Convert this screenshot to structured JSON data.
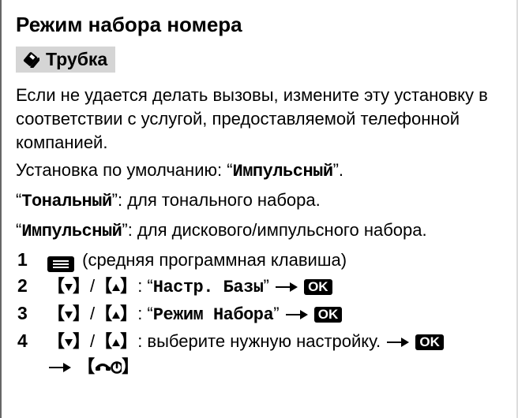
{
  "title": "Режим набора номера",
  "subheader": "Трубка",
  "desc1": "Если не удается делать вызовы, измените эту установку в соответствии с услугой, предоставляемой телефонной компанией.",
  "default_line_prefix": "Установка по умолчанию: “",
  "default_value": "Импульсный",
  "default_line_suffix": "”.",
  "tone_label": "Тональный",
  "tone_desc": ": для тонального набора.",
  "pulse_label": "Импульсный",
  "pulse_desc": ": для дискового/импульсного набора.",
  "steps": {
    "s1": {
      "n": "1",
      "text": "(средняя программная клавиша)"
    },
    "s2": {
      "n": "2",
      "menu": "Настр. Базы"
    },
    "s3": {
      "n": "3",
      "menu": "Режим Набора"
    },
    "s4": {
      "n": "4",
      "text": "выберите нужную настройку."
    }
  },
  "ok": "OK"
}
